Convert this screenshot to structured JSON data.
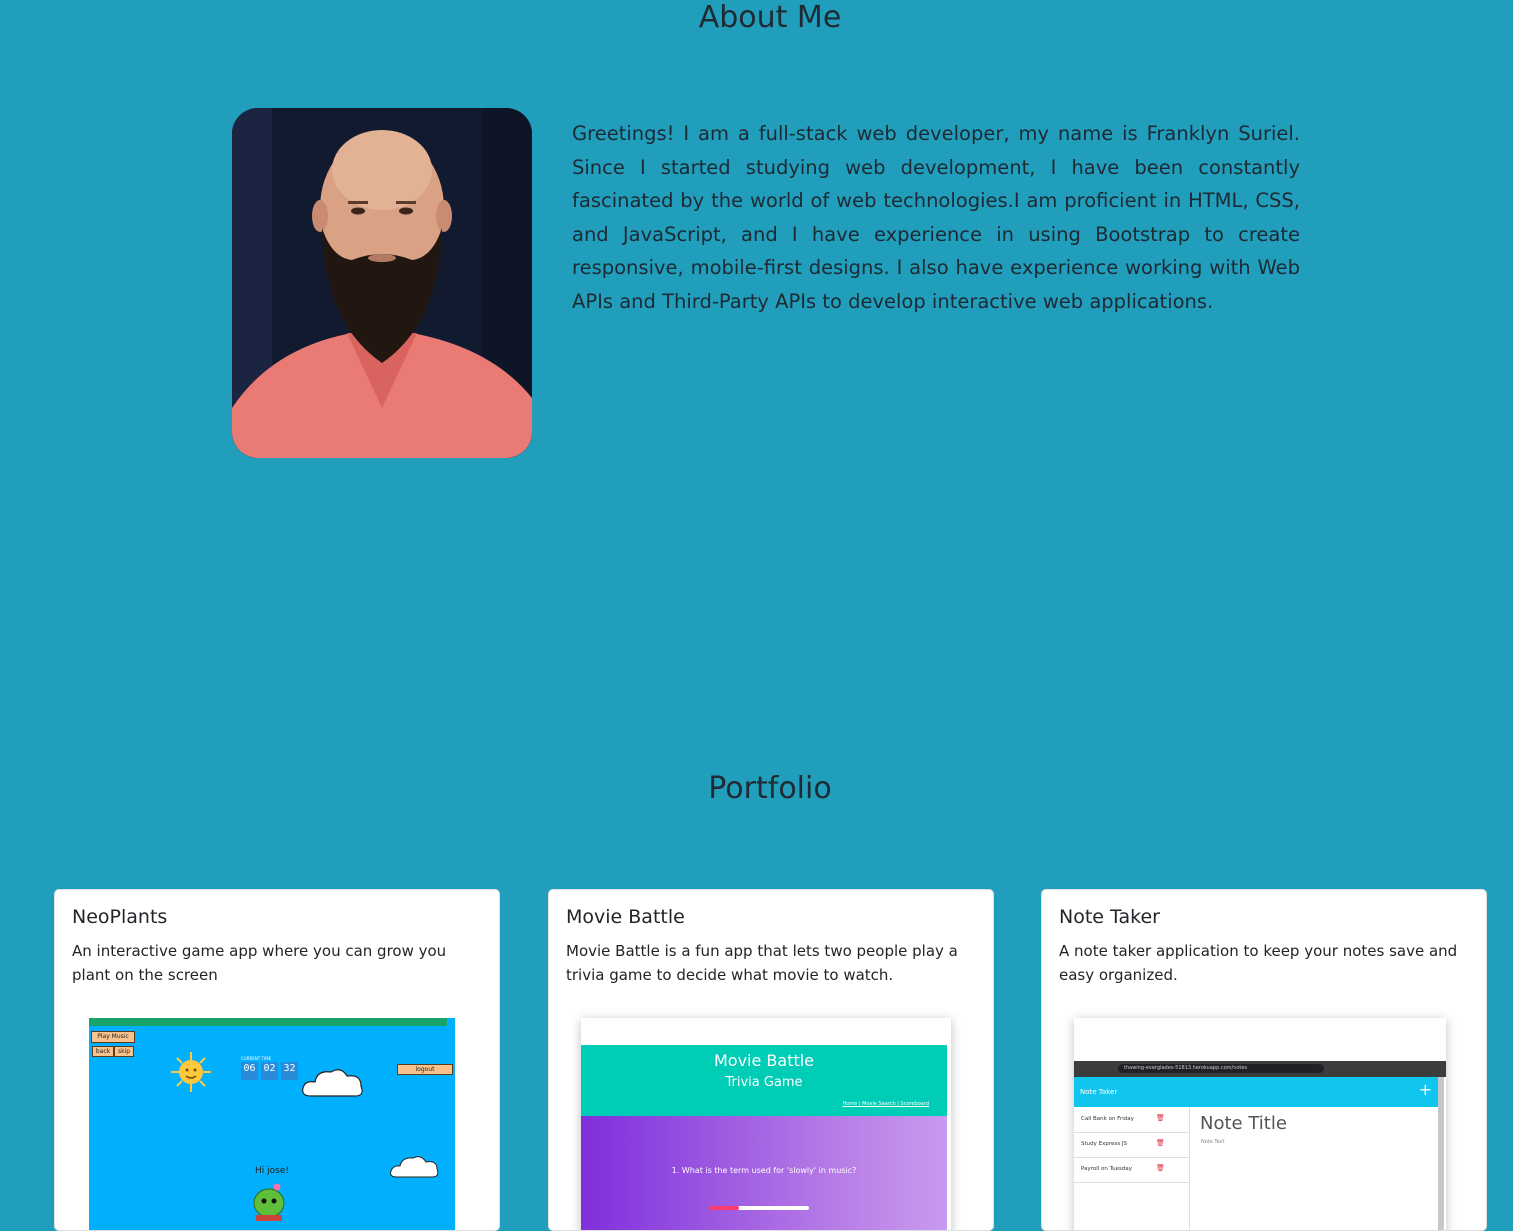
{
  "about": {
    "title": "About Me",
    "bio": "Greetings! I am a full-stack web developer, my name is Franklyn Suriel. Since I started studying web development, I have been constantly fascinated by the world of web technologies.I am proficient in HTML, CSS, and JavaScript, and I have experience in using Bootstrap to create responsive, mobile-first designs. I also have experience working with Web APIs and Third-Party APIs to develop interactive web applications."
  },
  "portfolio": {
    "title": "Portfolio",
    "cards": [
      {
        "title": "NeoPlants",
        "description": "An interactive game app where you can grow you plant on the screen",
        "screenshot": {
          "buttons": [
            "Play Music",
            "back",
            "skip",
            "logout"
          ],
          "time_label": "CURRENT TIME",
          "time": [
            "06",
            "02",
            "32"
          ],
          "greeting": "Hi jose!"
        }
      },
      {
        "title": "Movie Battle",
        "description": "Movie Battle is a fun app that lets two people play a trivia game to decide what movie to watch.",
        "screenshot": {
          "title": "Movie Battle",
          "subtitle": "Trivia Game",
          "links": "Home | Movie Search | Scoreboard",
          "question": "1. What is the term used for 'slowly' in music?",
          "progress": 0.3
        }
      },
      {
        "title": "Note Taker",
        "description": "A note taker application to keep your notes save and easy organized.",
        "screenshot": {
          "url": "thawing-everglades-51813.herokuapp.com/notes",
          "app_title": "Note Taker",
          "notes": [
            "Call Bank on Friday",
            "Study Express JS",
            "Payroll on Tuesday"
          ],
          "note_title": "Note Title",
          "note_text": "Note Text"
        }
      }
    ]
  },
  "colors": {
    "background": "#219ebc",
    "neoplants_sky": "#00b0ff",
    "moviebattle_header": "#00cdb5",
    "notetaker_nav": "#10c5ee"
  }
}
